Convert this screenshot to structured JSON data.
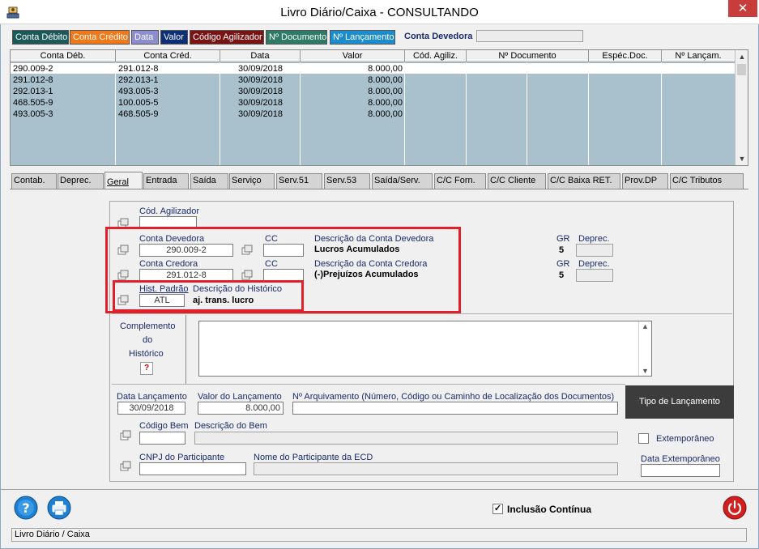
{
  "window": {
    "title": "Livro Diário/Caixa   -   CONSULTANDO",
    "close_label": "✕"
  },
  "top_tabs": [
    {
      "label": "Conta Débito",
      "bg": "#1c5a5a",
      "fg": "#ffffff"
    },
    {
      "label": "Conta Crédito",
      "bg": "#f07818",
      "fg": "#ffffff"
    },
    {
      "label": "Data",
      "bg": "#8c8cd0",
      "fg": "#ffffff"
    },
    {
      "label": "Valor",
      "bg": "#0c2f78",
      "fg": "#ffffff"
    },
    {
      "label": "Código Agilizador",
      "bg": "#7a1414",
      "fg": "#ffffff"
    },
    {
      "label": "Nº Documento",
      "bg": "#2d7a66",
      "fg": "#ffffff"
    },
    {
      "label": "Nº Lançamento",
      "bg": "#1c8ccc",
      "fg": "#ffffff"
    }
  ],
  "conta_devedora_label": "Conta Devedora",
  "grid": {
    "columns": [
      "Conta Déb.",
      "Conta Créd.",
      "Data",
      "Valor",
      "Cód. Agiliz.",
      "Nº Documento",
      "Espéc.Doc.",
      "Nº Lançam."
    ],
    "rows": [
      [
        "290.009-2",
        "291.012-8",
        "30/09/2018",
        "8.000,00"
      ],
      [
        "291.012-8",
        "292.013-1",
        "30/09/2018",
        "8.000,00"
      ],
      [
        "292.013-1",
        "493.005-3",
        "30/09/2018",
        "8.000,00"
      ],
      [
        "468.505-9",
        "100.005-5",
        "30/09/2018",
        "8.000,00"
      ],
      [
        "493.005-3",
        "468.505-9",
        "30/09/2018",
        "8.000,00"
      ]
    ]
  },
  "section_tabs": [
    "Contab.",
    "Deprec.",
    "Geral",
    "Entrada",
    "Saída",
    "Serviço",
    "Serv.51",
    "Serv.53",
    "Saída/Serv.",
    "C/C Forn.",
    "C/C Cliente",
    "C/C Baixa RET.",
    "Prov.DP",
    "C/C Tributos"
  ],
  "form": {
    "cod_agilizador_label": "Cód. Agilizador",
    "cod_agilizador_value": "",
    "conta_devedora_label": "Conta Devedora",
    "conta_devedora_value": "290.009-2",
    "cc_label": "CC",
    "desc_conta_devedora_label": "Descrição da Conta Devedora",
    "desc_conta_devedora_value": "Lucros Acumulados",
    "gr_label": "GR",
    "gr_devedora_value": "5",
    "deprec_label": "Deprec.",
    "conta_credora_label": "Conta Credora",
    "conta_credora_value": "291.012-8",
    "desc_conta_credora_label": "Descrição da Conta Credora",
    "desc_conta_credora_value": "(-)Prejuízos Acumulados",
    "gr_credora_value": "5",
    "hist_padrao_label": "Hist. Padrão",
    "hist_padrao_value": "ATL",
    "desc_historico_label": "Descrição do Histórico",
    "desc_historico_value": "aj. trans. lucro",
    "complemento_line1": "Complemento",
    "complemento_line2": "do",
    "complemento_line3": "Histórico",
    "help_label": "?",
    "data_lancamento_label": "Data Lançamento",
    "data_lancamento_value": "30/09/2018",
    "valor_lancamento_label": "Valor do Lançamento",
    "valor_lancamento_value": "8.000,00",
    "arquivamento_label": "Nº Arquivamento (Número, Código ou Caminho de Localização dos Documentos)",
    "codigo_bem_label": "Código Bem",
    "descricao_bem_label": "Descrição do Bem",
    "cnpj_label": "CNPJ do Participante",
    "nome_participante_label": "Nome do Participante da ECD",
    "tipo_lancamento_label": "Tipo de Lançamento",
    "extemporaneo_label": "Extemporâneo",
    "data_extemporaneo_label": "Data Extemporâneo"
  },
  "bottom": {
    "inclusao_continua_label": "Inclusão Contínua",
    "inclusao_continua_checked": true,
    "status_text": "Livro Diário / Caixa"
  }
}
